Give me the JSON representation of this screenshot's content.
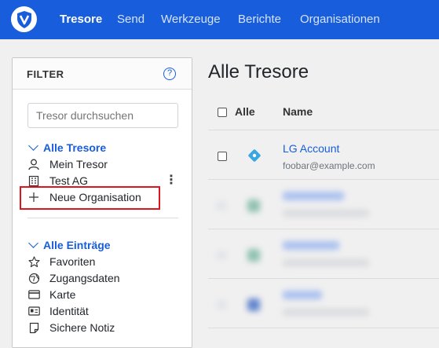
{
  "nav": {
    "logo_icon": "bitwarden-shield-icon",
    "items": [
      {
        "label": "Tresore",
        "active": true
      },
      {
        "label": "Send"
      },
      {
        "label": "Werkzeuge"
      },
      {
        "label": "Berichte"
      },
      {
        "label": "Organisationen"
      }
    ]
  },
  "filter": {
    "title": "FILTER",
    "help_icon": "question-circle-icon",
    "search_placeholder": "Tresor durchsuchen",
    "vaults_group": "Alle Tresore",
    "vaults": [
      {
        "label": "Mein Tresor",
        "icon": "user-icon"
      },
      {
        "label": "Test AG",
        "icon": "building-icon"
      },
      {
        "label": "Neue Organisation",
        "icon": "plus-icon"
      }
    ],
    "entries_group": "Alle Einträge",
    "entries": [
      {
        "label": "Favoriten",
        "icon": "star-icon"
      },
      {
        "label": "Zugangsdaten",
        "icon": "globe-icon"
      },
      {
        "label": "Karte",
        "icon": "credit-card-icon"
      },
      {
        "label": "Identität",
        "icon": "id-card-icon"
      },
      {
        "label": "Sichere Notiz",
        "icon": "note-icon"
      }
    ]
  },
  "main": {
    "title": "Alle Tresore",
    "col_all": "Alle",
    "col_name": "Name",
    "rows": [
      {
        "name": "LG Account",
        "sub": "foobar@example.com"
      }
    ]
  },
  "colors": {
    "brand": "#175ddc",
    "highlight": "#e0141c"
  }
}
